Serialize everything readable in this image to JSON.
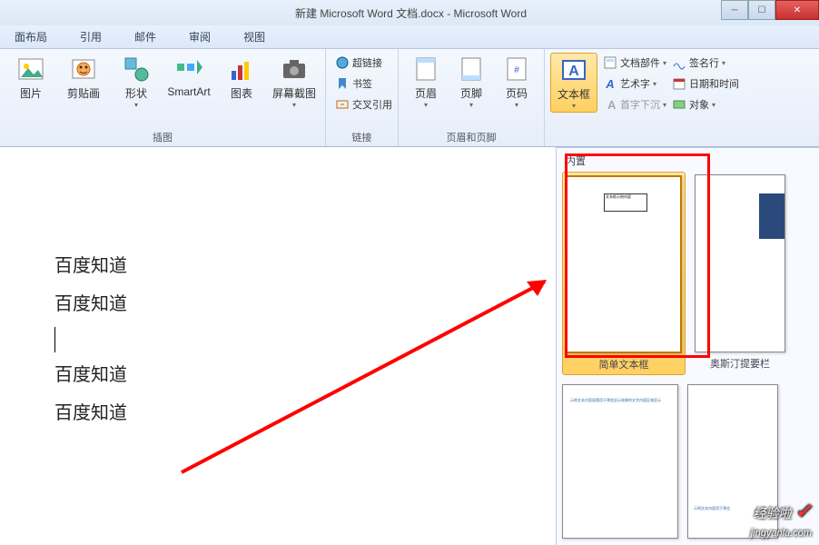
{
  "window": {
    "title_doc": "新建 Microsoft Word 文档.docx",
    "title_app": "Microsoft Word"
  },
  "tabs": [
    "面布局",
    "引用",
    "邮件",
    "审阅",
    "视图"
  ],
  "ribbon": {
    "illustrations": {
      "label": "插图",
      "picture": "图片",
      "clipart": "剪贴画",
      "shapes": "形状",
      "smartart": "SmartArt",
      "chart": "图表",
      "screenshot": "屏幕截图"
    },
    "links": {
      "label": "链接",
      "hyperlink": "超链接",
      "bookmark": "书签",
      "crossref": "交叉引用"
    },
    "headerfooter": {
      "label": "页眉和页脚",
      "header": "页眉",
      "footer": "页脚",
      "pagenumber": "页码"
    },
    "text": {
      "textbox": "文本框",
      "quickparts": "文档部件",
      "signature": "签名行",
      "wordart": "艺术字",
      "datetime": "日期和时间",
      "dropcap": "首字下沉",
      "object": "对象"
    }
  },
  "gallery": {
    "header": "内置",
    "item1": "简单文本框",
    "item2": "奥斯汀提要栏"
  },
  "document": {
    "lines": [
      "百度知道",
      "百度知道",
      "百度知道",
      "百度知道"
    ]
  },
  "watermark": {
    "brand": "经验啦",
    "url": "jingyanla.com"
  }
}
